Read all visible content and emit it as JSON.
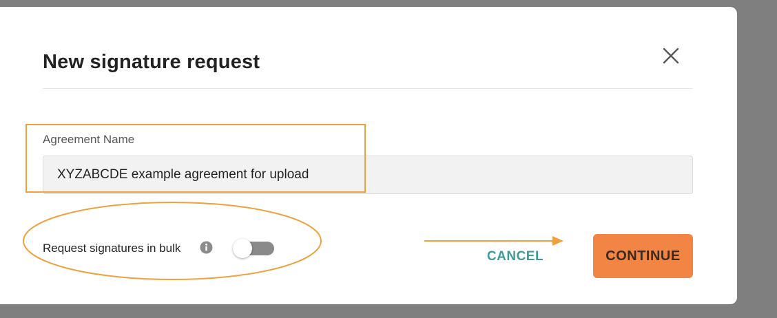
{
  "dialog": {
    "title": "New signature request",
    "close_icon": "close-icon"
  },
  "agreement": {
    "label": "Agreement Name",
    "value": "XYZABCDE example agreement for upload"
  },
  "bulk": {
    "label": "Request signatures in bulk",
    "info_icon": "info-icon",
    "enabled": false
  },
  "actions": {
    "cancel_label": "CANCEL",
    "continue_label": "CONTINUE"
  },
  "colors": {
    "annotation": "#f0a03c",
    "accent_teal": "#3d9c9a",
    "primary_orange": "#f28444",
    "overlay": "#7f7f7f"
  }
}
